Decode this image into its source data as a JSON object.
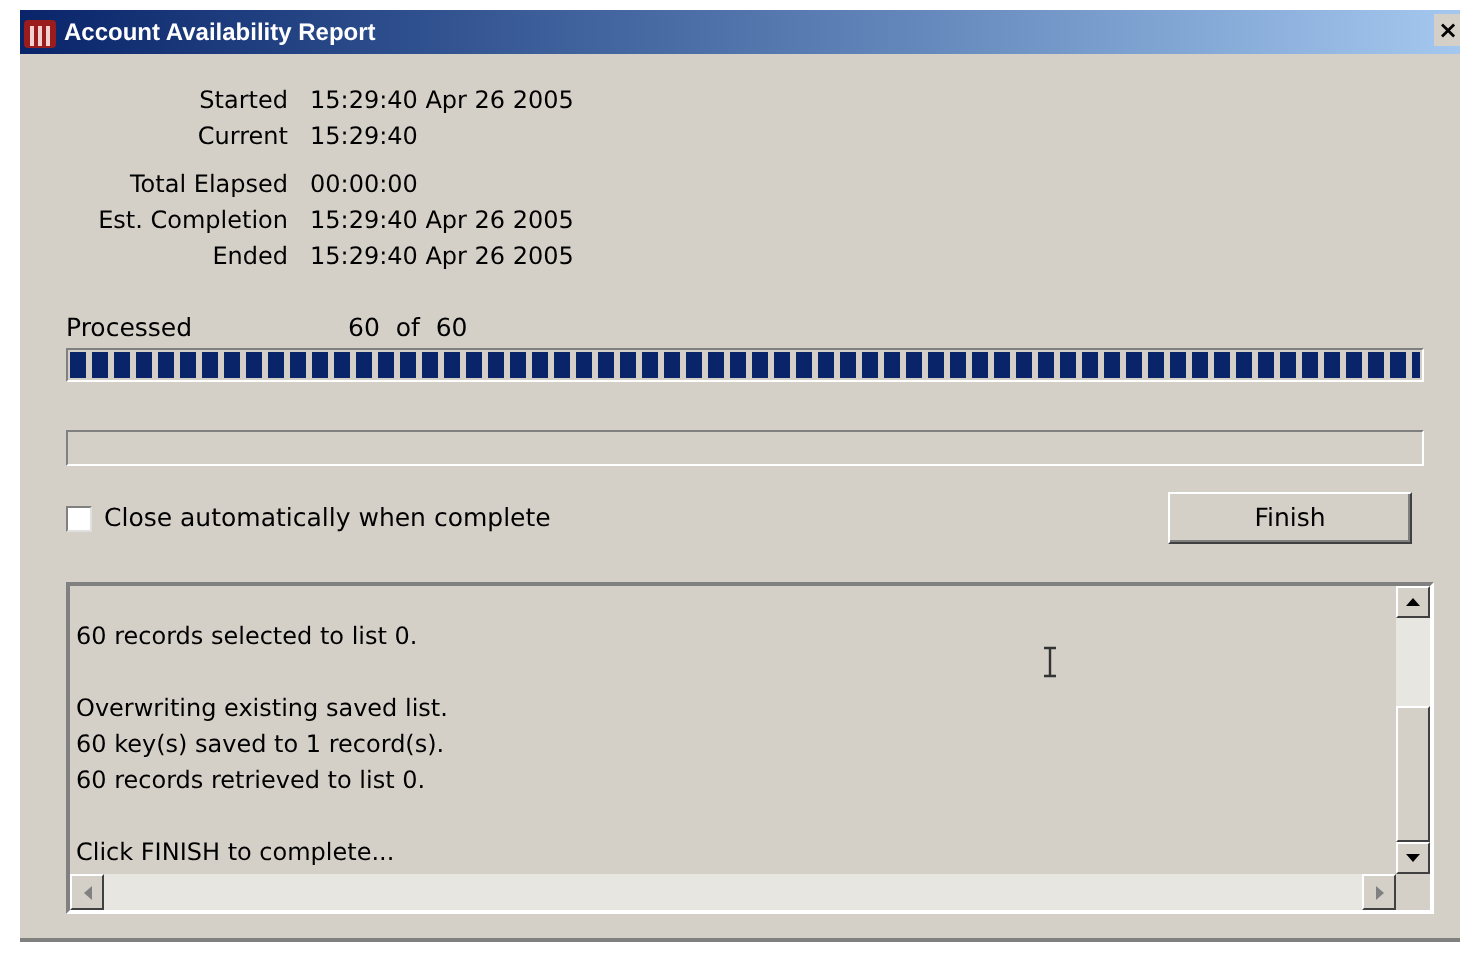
{
  "window": {
    "title": "Account Availability Report",
    "close": "×"
  },
  "time_groups": [
    [
      {
        "label": "Started",
        "value": "15:29:40 Apr 26 2005"
      },
      {
        "label": "Current",
        "value": "15:29:40"
      }
    ],
    [
      {
        "label": "Total Elapsed",
        "value": "00:00:00"
      },
      {
        "label": "Est. Completion",
        "value": "15:29:40 Apr 26 2005"
      },
      {
        "label": "Ended",
        "value": "15:29:40 Apr 26 2005"
      }
    ]
  ],
  "progress": {
    "label": "Processed",
    "count": "60",
    "of": "of",
    "total": "60",
    "level": 1
  },
  "secondary_progress": {
    "level": 0
  },
  "close_automatically": {
    "label": "Close automatically when complete",
    "checked": false
  },
  "finish_button": "Finish",
  "log_paragraphs": [
    [
      "60 records selected to list 0."
    ],
    [
      "Overwriting existing saved list.",
      "60 key(s) saved to 1 record(s).",
      "60 records retrieved to list 0."
    ],
    [
      "Click FINISH to complete..."
    ]
  ]
}
